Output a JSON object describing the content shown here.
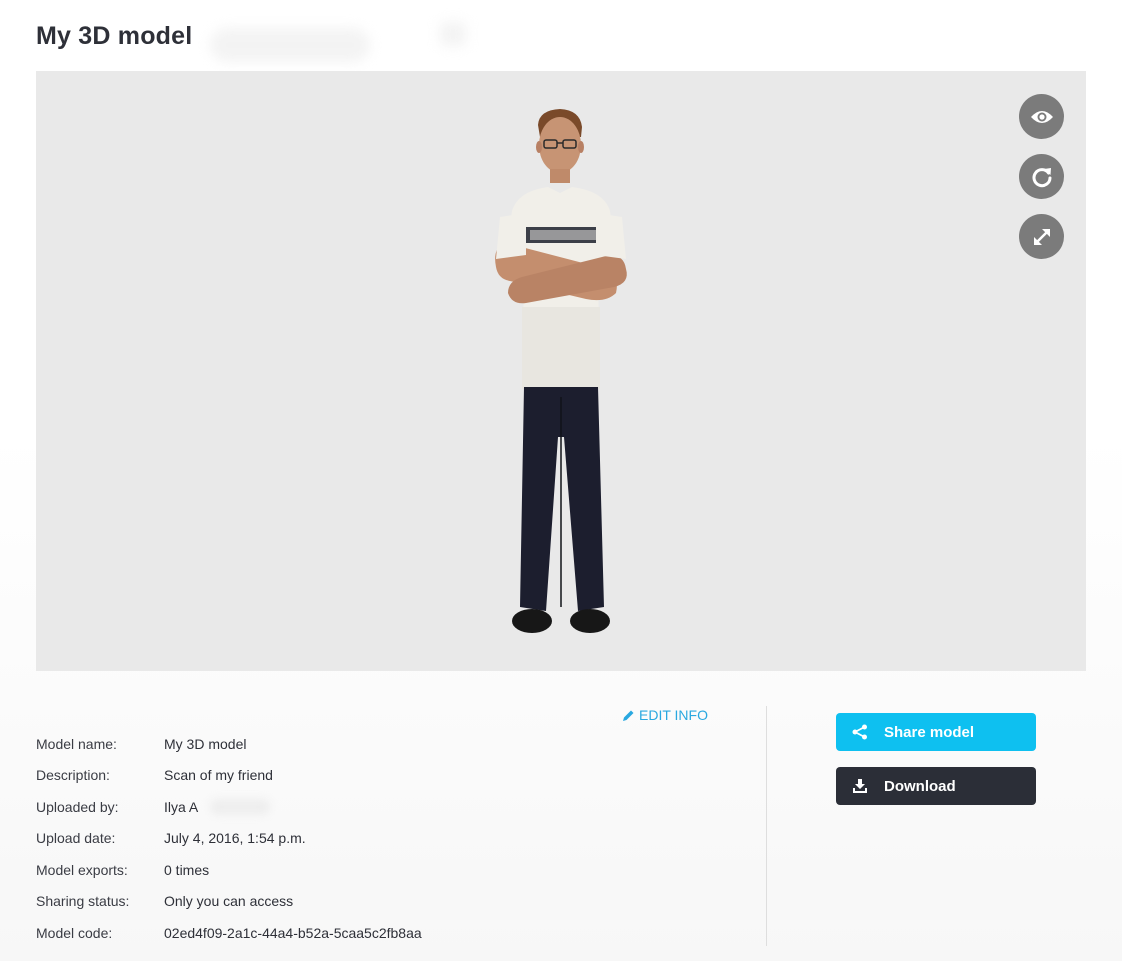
{
  "page": {
    "title": "My 3D model"
  },
  "viewer": {
    "controls": [
      {
        "icon": "eye-icon"
      },
      {
        "icon": "refresh-icon"
      },
      {
        "icon": "fullscreen-icon"
      }
    ]
  },
  "info": {
    "edit_label": "EDIT INFO",
    "rows": [
      {
        "label": "Model name:",
        "value": "My 3D model"
      },
      {
        "label": "Description:",
        "value": "Scan of my friend"
      },
      {
        "label": "Uploaded by:",
        "value": "Ilya A"
      },
      {
        "label": "Upload date:",
        "value": "July 4, 2016, 1:54 p.m."
      },
      {
        "label": "Model exports:",
        "value": "0 times"
      },
      {
        "label": "Sharing status:",
        "value": "Only you can access"
      },
      {
        "label": "Model code:",
        "value": "02ed4f09-2a1c-44a4-b52a-5caa5c2fb8aa"
      }
    ]
  },
  "actions": {
    "share_label": "Share model",
    "download_label": "Download"
  },
  "colors": {
    "accent": "#0ec0f0",
    "link": "#29a8e0",
    "dark_button": "#2b2e37",
    "viewer_bg": "#e9e9e9",
    "control_bg": "#7b7b7b"
  }
}
